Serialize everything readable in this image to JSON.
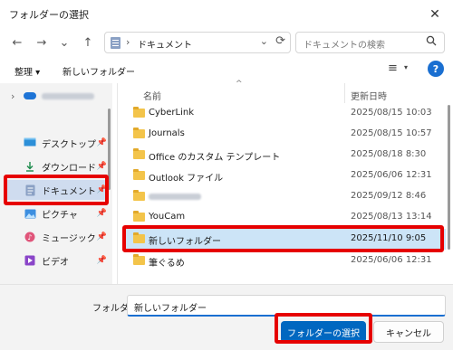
{
  "window": {
    "title": "フォルダーの選択",
    "close_glyph": "✕"
  },
  "nav": {
    "back": "←",
    "forward": "→",
    "recent": "⌄",
    "up": "↑",
    "address": {
      "separator": "›",
      "path": "ドキュメント",
      "dropdown": "⌄",
      "refresh": "⟳"
    },
    "search": {
      "placeholder": "ドキュメントの検索",
      "icon": "search-icon"
    }
  },
  "toolbar": {
    "organize": "整理 ▾",
    "new_folder": "新しいフォルダー",
    "view_icon": "≡",
    "view_dropdown": "▾",
    "help": "?"
  },
  "sidebar": {
    "items": [
      {
        "label": "",
        "icon": "cloud-icon",
        "expander": "›",
        "redacted": true
      },
      {
        "label": "デスクトップ",
        "icon": "desktop-icon",
        "pinned": true
      },
      {
        "label": "ダウンロード",
        "icon": "download-icon",
        "pinned": true
      },
      {
        "label": "ドキュメント",
        "icon": "documents-icon",
        "pinned": true,
        "selected": true
      },
      {
        "label": "ピクチャ",
        "icon": "pictures-icon",
        "pinned": true
      },
      {
        "label": "ミュージック",
        "icon": "music-icon",
        "pinned": true
      },
      {
        "label": "ビデオ",
        "icon": "video-icon",
        "pinned": true
      }
    ]
  },
  "files": {
    "columns": {
      "name": "名前",
      "date": "更新日時",
      "sort_glyph": "^"
    },
    "rows": [
      {
        "name": "CyberLink",
        "date": "2025/08/15 10:03"
      },
      {
        "name": "Journals",
        "date": "2025/08/15 10:57"
      },
      {
        "name": "Office のカスタム テンプレート",
        "date": "2025/08/18 8:30"
      },
      {
        "name": "Outlook ファイル",
        "date": "2025/06/06 12:31"
      },
      {
        "name": "",
        "date": "2025/09/12 8:46",
        "redacted": true
      },
      {
        "name": "YouCam",
        "date": "2025/08/13 13:14"
      },
      {
        "name": "新しいフォルダー",
        "date": "2025/11/10 9:05",
        "selected": true
      },
      {
        "name": "筆ぐるめ",
        "date": "2025/06/06 12:31"
      }
    ]
  },
  "footer": {
    "folder_label": "フォルダー:",
    "folder_value": "新しいフォルダー",
    "select_button": "フォルダーの選択",
    "cancel_button": "キャンセル"
  },
  "colors": {
    "accent": "#0067c0",
    "highlight": "#e60000",
    "selection": "#cce4f7",
    "folder": "#f3c44a"
  }
}
